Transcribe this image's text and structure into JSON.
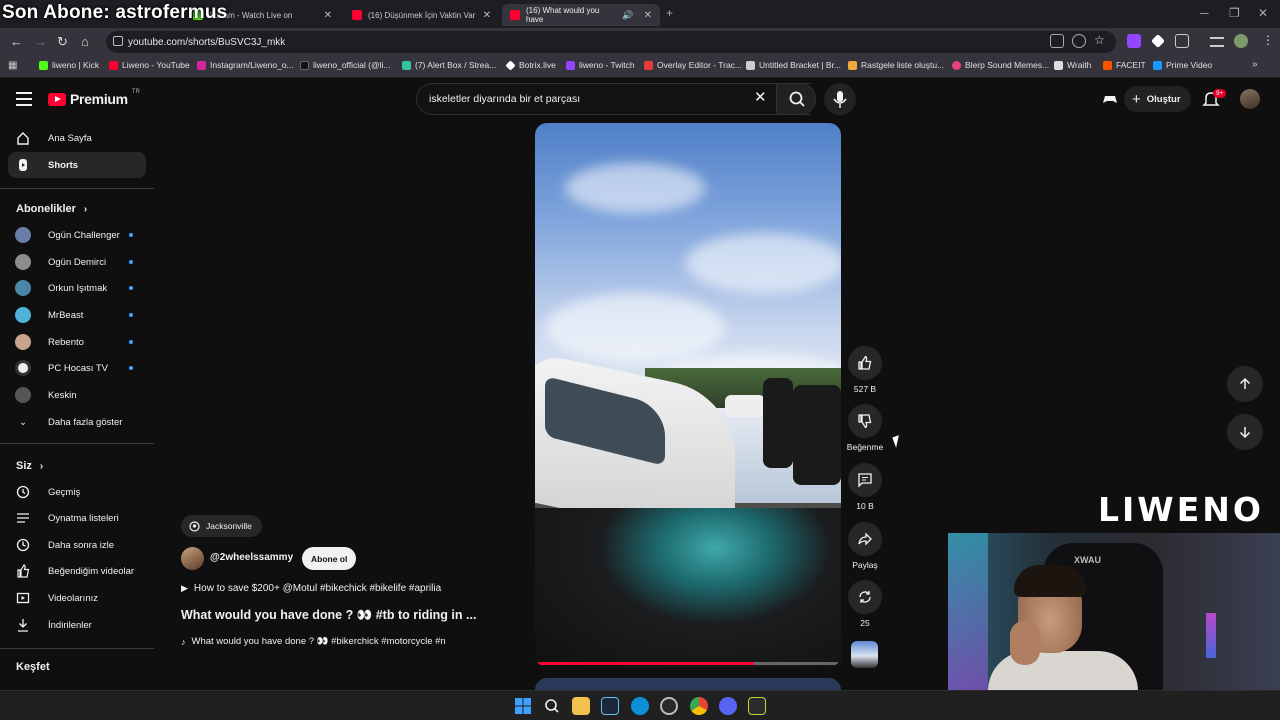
{
  "overlay_text": "Son Abone: astrofermus",
  "browser": {
    "tabs": [
      {
        "label": "Stream - Watch Live on",
        "fav_color": "#53fc18"
      },
      {
        "label": "(16) Düşünmek İçin Vaktin Var",
        "fav_color": "#ff0033"
      },
      {
        "label": "(16) What would you have",
        "fav_color": "#ff0033",
        "active": true
      }
    ],
    "new_tab": "+",
    "url": "youtube.com/shorts/BuSVC3J_mkk",
    "bookmarks": [
      {
        "label": "liweno | Kick",
        "color": "#53fc18"
      },
      {
        "label": "Liweno - YouTube",
        "color": "#ff0033"
      },
      {
        "label": "Instagram/Liweno_o...",
        "color": "#d6249f"
      },
      {
        "label": "liweno_official (@li...",
        "color": "#111111"
      },
      {
        "label": "(7) Alert Box / Strea...",
        "color": "#31c3a2"
      },
      {
        "label": "Botrix.live",
        "color": "#ffffff"
      },
      {
        "label": "liweno - Twitch",
        "color": "#9146ff"
      },
      {
        "label": "Overlay Editor - Trac...",
        "color": "#e83a3a"
      },
      {
        "label": "Untitled Bracket | Br...",
        "color": "#cccccc"
      },
      {
        "label": "Rastgele liste oluştu...",
        "color": "#f2a93b"
      },
      {
        "label": "Blerp Sound Memes...",
        "color": "#e8417a"
      },
      {
        "label": "Wraith",
        "color": "#dddddd"
      },
      {
        "label": "FACEIT",
        "color": "#ff5500"
      },
      {
        "label": "Prime Video",
        "color": "#1a98ff"
      }
    ]
  },
  "youtube": {
    "logo_text": "Premium",
    "logo_region": "TR",
    "search_query": "iskeletler diyarında bir et parçası",
    "create_label": "Oluştur",
    "notif_count": "9+"
  },
  "sidebar": {
    "main": [
      {
        "label": "Ana Sayfa",
        "icon": "home-icon"
      },
      {
        "label": "Shorts",
        "icon": "shorts-icon",
        "active": true
      }
    ],
    "subs_title": "Abonelikler",
    "subscriptions": [
      {
        "label": "Ogün Challenger",
        "color": "#6a7fa8",
        "dot": true
      },
      {
        "label": "Ogün Demirci",
        "color": "#8c8c8c",
        "dot": true
      },
      {
        "label": "Orkun Işıtmak",
        "color": "#4a86a8",
        "dot": true
      },
      {
        "label": "MrBeast",
        "color": "#4fb0d9",
        "dot": true
      },
      {
        "label": "Rebento",
        "color": "#c9a48c",
        "dot": true
      },
      {
        "label": "PC Hocası TV",
        "color": "#eeeeee",
        "dot": true
      },
      {
        "label": "Keskin",
        "color": "#555555",
        "dot": false
      }
    ],
    "show_more": "Daha fazla göster",
    "you_title": "Siz",
    "you_items": [
      {
        "label": "Geçmiş",
        "icon": "history-icon"
      },
      {
        "label": "Oynatma listeleri",
        "icon": "playlists-icon"
      },
      {
        "label": "Daha sonra izle",
        "icon": "watch-later-icon"
      },
      {
        "label": "Beğendiğim videolar",
        "icon": "liked-videos-icon"
      },
      {
        "label": "Videolarınız",
        "icon": "your-videos-icon"
      },
      {
        "label": "İndirilenler",
        "icon": "downloads-icon"
      }
    ],
    "explore_title": "Keşfet"
  },
  "short": {
    "location": "Jacksonville",
    "channel": "@2wheelssammy",
    "subscribe_label": "Abone ol",
    "promo": "How to save $200+ @Motul #bikechick #bikelife #aprilia",
    "title": "What would you have done ? 👀 #tb to riding in ...",
    "sound": "What would you have done ? 👀 #bikerchick #motorcycle #n",
    "progress": 0.72
  },
  "actions": {
    "likes": "527 B",
    "dislike": "Beğenme",
    "comments": "10 B",
    "share": "Paylaş",
    "remix": "25"
  },
  "watermark": "LIWENO"
}
